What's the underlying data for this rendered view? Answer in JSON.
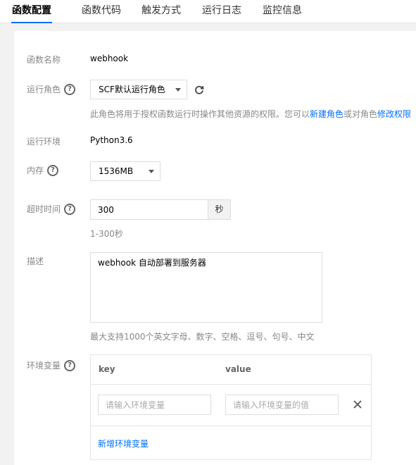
{
  "tabs": [
    {
      "label": "函数配置",
      "active": true
    },
    {
      "label": "函数代码",
      "active": false
    },
    {
      "label": "触发方式",
      "active": false
    },
    {
      "label": "运行日志",
      "active": false
    },
    {
      "label": "监控信息",
      "active": false
    }
  ],
  "form": {
    "name": {
      "label": "函数名称",
      "value": "webhook"
    },
    "role": {
      "label": "运行角色",
      "selected": "SCF默认运行角色",
      "hint_prefix": "此角色将用于授权函数运行时操作其他资源的权限。您可以",
      "hint_link1": "新建角色",
      "hint_middle": "或对角色",
      "hint_link2": "修改权限"
    },
    "runtime": {
      "label": "运行环境",
      "value": "Python3.6"
    },
    "memory": {
      "label": "内存",
      "selected": "1536MB"
    },
    "timeout": {
      "label": "超时时间",
      "value": "300",
      "unit": "秒",
      "hint": "1-300秒"
    },
    "description": {
      "label": "描述",
      "value": "webhook 自动部署到服务器",
      "hint": "最大支持1000个英文字母、数字、空格、逗号、句号、中文"
    },
    "env": {
      "label": "环境变量",
      "col_key": "key",
      "col_value": "value",
      "key_placeholder": "请输入环境变量",
      "value_placeholder": "请输入环境变量的值",
      "add_label": "新增环境变量"
    }
  },
  "colors": {
    "accent": "#006eff"
  },
  "icons": {
    "help": "?",
    "refresh": "refresh-icon",
    "close": "close-icon"
  }
}
